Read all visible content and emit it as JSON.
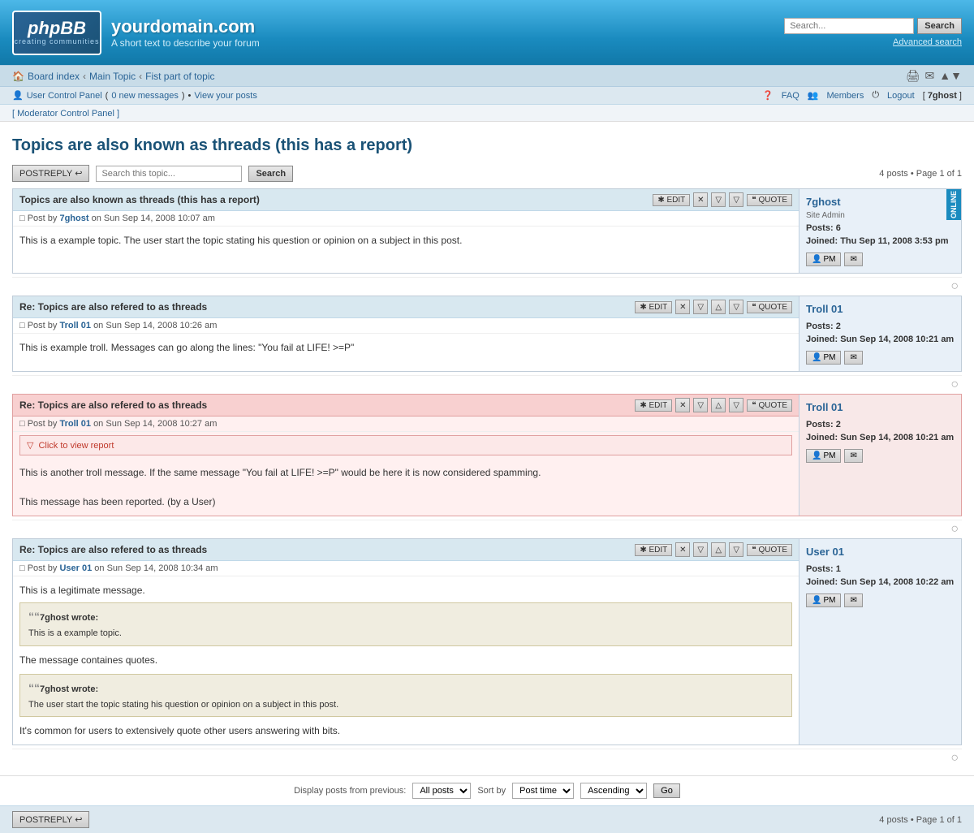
{
  "header": {
    "logo_text": "phpBB",
    "logo_sub": "creating communities",
    "site_title": "yourdomain.com",
    "site_desc": "A short text to describe your forum",
    "search_placeholder": "Search...",
    "search_btn": "Search",
    "advanced_search": "Advanced search"
  },
  "nav": {
    "breadcrumb": [
      "Board index",
      "Main Topic",
      "Fist part of topic"
    ],
    "icons": [
      "🖨",
      "✉",
      "▲▼"
    ]
  },
  "userbar": {
    "user_icon": "👤",
    "user_control": "User Control Panel",
    "new_messages": "0 new messages",
    "view_posts": "View your posts",
    "faq": "FAQ",
    "members": "Members",
    "logout": "Logout",
    "username": "7ghost"
  },
  "mod_panel": {
    "label": "[ Moderator Control Panel ]"
  },
  "topic": {
    "title": "Topics are also known as threads (this has a report)",
    "page_info": "4 posts • Page 1 of 1",
    "page_info_bottom": "4 posts • Page 1 of 1",
    "post_reply_btn": "POSTREPLY",
    "search_placeholder": "Search this topic...",
    "search_btn": "Search"
  },
  "posts": [
    {
      "id": "post1",
      "title": "Topics are also known as threads (this has a report)",
      "by_label": "Post by",
      "author": "7ghost",
      "date": "Sun Sep 14, 2008 10:07 am",
      "body": "This is a example topic. The user start the topic stating his question or opinion on a subject in this post.",
      "reported": false,
      "author_info": {
        "name": "7ghost",
        "role": "Site Admin",
        "posts_label": "Posts:",
        "posts": "6",
        "joined_label": "Joined:",
        "joined": "Thu Sep 11, 2008 3:53 pm",
        "online": true
      },
      "quotes": []
    },
    {
      "id": "post2",
      "title": "Re: Topics are also refered to as threads",
      "by_label": "Post by",
      "author": "Troll 01",
      "date": "Sun Sep 14, 2008 10:26 am",
      "body": "This is example troll. Messages can go along the lines: \"You fail at LIFE! >=P\"",
      "reported": false,
      "author_info": {
        "name": "Troll 01",
        "role": "",
        "posts_label": "Posts:",
        "posts": "2",
        "joined_label": "Joined:",
        "joined": "Sun Sep 14, 2008 10:21 am",
        "online": false
      },
      "quotes": []
    },
    {
      "id": "post3",
      "title": "Re: Topics are also refered to as threads",
      "by_label": "Post by",
      "author": "Troll 01",
      "date": "Sun Sep 14, 2008 10:27 am",
      "body_part1": "This is another troll message. If the same message \"You fail at LIFE! >=P\" would be here it is now considered spamming.",
      "body_part2": "This message has been reported. (by a User)",
      "reported": true,
      "report_notice": "Click to view report",
      "author_info": {
        "name": "Troll 01",
        "role": "",
        "posts_label": "Posts:",
        "posts": "2",
        "joined_label": "Joined:",
        "joined": "Sun Sep 14, 2008 10:21 am",
        "online": false
      },
      "quotes": []
    },
    {
      "id": "post4",
      "title": "Re: Topics are also refered to as threads",
      "by_label": "Post by",
      "author": "User 01",
      "date": "Sun Sep 14, 2008 10:34 am",
      "body_intro": "This is a legitimate message.",
      "body_middle": "The message containes quotes.",
      "body_end": "It's common for users to extensively quote other users answering with bits.",
      "reported": false,
      "author_info": {
        "name": "User 01",
        "role": "",
        "posts_label": "Posts:",
        "posts": "1",
        "joined_label": "Joined:",
        "joined": "Sun Sep 14, 2008 10:22 am",
        "online": false
      },
      "quotes": [
        {
          "author": "7ghost wrote:",
          "text": "This is a example topic."
        },
        {
          "author": "7ghost wrote:",
          "text": "The user start the topic stating his question or opinion on a subject in this post."
        }
      ]
    }
  ],
  "bottom_bar": {
    "display_label": "Display posts from previous:",
    "all_posts": "All posts",
    "sort_by": "Sort by",
    "post_time": "Post time",
    "ascending": "Ascending",
    "go_btn": "Go"
  },
  "footer": {
    "post_reply_btn": "POSTREPLY",
    "page_info": "4 posts • Page 1 of 1"
  }
}
